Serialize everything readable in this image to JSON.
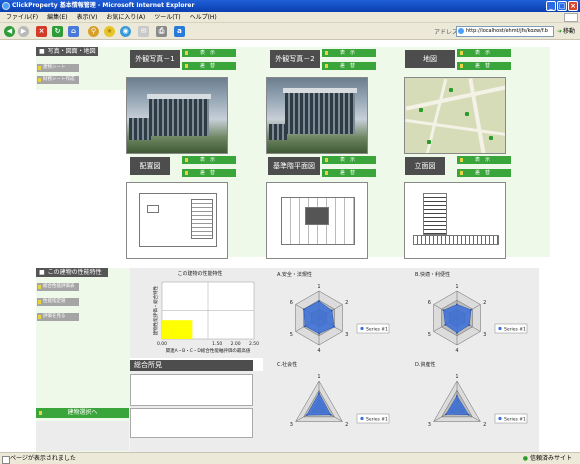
{
  "window": {
    "title": "ClickProperty 基本情報管理 - Microsoft Internet Explorer",
    "min": "_",
    "max": "□",
    "close": "×"
  },
  "menu": [
    "ファイル(F)",
    "編集(E)",
    "表示(V)",
    "お気に入り(A)",
    "ツール(T)",
    "ヘルプ(H)"
  ],
  "address": {
    "label": "アドレス(D)",
    "value": "http://localhost/ehmt/jfs/kozw/f.b",
    "go": "移動"
  },
  "toolbar_icons": [
    "back-icon",
    "forward-icon",
    "stop-icon",
    "refresh-icon",
    "home-icon",
    "search-icon",
    "favorites-icon",
    "media-icon",
    "mail-icon",
    "print-icon",
    "edit-icon"
  ],
  "section1": {
    "title": "写真・図面・地図",
    "side_buttons": [
      "建物シート",
      "財務シート作成"
    ],
    "panels": [
      {
        "title": "外観写真－1",
        "btn1": "表　示",
        "btn2": "差　替"
      },
      {
        "title": "外観写真－2",
        "btn1": "表　示",
        "btn2": "差　替"
      },
      {
        "title": "地図",
        "btn1": "表　示",
        "btn2": "差　替"
      },
      {
        "title": "配置図",
        "btn1": "表　示",
        "btn2": "差　替"
      },
      {
        "title": "基準階平面図",
        "btn1": "表　示",
        "btn2": "差　替"
      },
      {
        "title": "立面図",
        "btn1": "表　示",
        "btn2": "差　替"
      }
    ]
  },
  "section2": {
    "title": "この建物の性能特性",
    "side_buttons": [
      "総合性能評価表",
      "性能指定値",
      "評価を見る"
    ],
    "select_button": "建物選択へ",
    "opinion_title": "総合所見"
  },
  "chart_data": [
    {
      "type": "scatter",
      "title": "この建物の性能特性",
      "xlabel": "関連A・B・C・D総合性能軸評価の最高値",
      "ylabel": "建物性能評価・総合特性",
      "x_ticks": [
        "0.00",
        "1.50",
        "2.00",
        "2.50"
      ],
      "xlim": [
        0,
        2.5
      ],
      "highlight_region": {
        "x": [
          0,
          1.5
        ],
        "y": [
          0,
          1.5
        ],
        "color": "#ffff00"
      }
    },
    {
      "type": "radar",
      "title": "A.安全・法規性",
      "axes": [
        "1",
        "2",
        "3",
        "4",
        "5",
        "6"
      ],
      "legend": "Series #1",
      "values": [
        2.5,
        2.2,
        2.6,
        2.3,
        2.4,
        2.6
      ],
      "max": 4
    },
    {
      "type": "radar",
      "title": "B.快適・利便性",
      "axes": [
        "1",
        "2",
        "3",
        "4",
        "5",
        "6"
      ],
      "legend": "Series #1",
      "values": [
        2.0,
        2.4,
        2.1,
        2.2,
        2.0,
        2.3
      ],
      "max": 4
    },
    {
      "type": "radar",
      "title": "C.社会性",
      "axes": [
        "1",
        "2",
        "3"
      ],
      "legend": "Series #1",
      "values": [
        2.2,
        2.0,
        2.1
      ],
      "max": 4
    },
    {
      "type": "radar",
      "title": "D.資産性",
      "axes": [
        "1",
        "2",
        "3"
      ],
      "legend": "Series #1",
      "values": [
        1.8,
        2.0,
        1.9
      ],
      "max": 4
    }
  ],
  "status": {
    "left": "ページが表示されました",
    "right": "信頼済みサイト"
  },
  "colors": {
    "green": "#3aa53a",
    "dark_header": "#4d4d4d",
    "panel_bg": "#eef9ea",
    "series": "#3a6fd8"
  }
}
